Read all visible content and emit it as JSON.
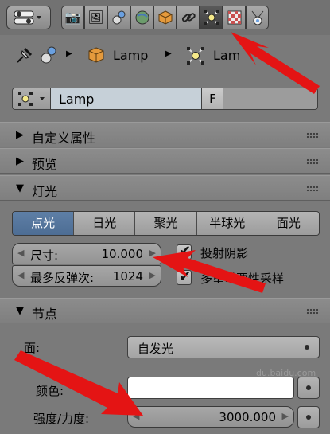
{
  "toolbar": {
    "icons": [
      "view-toggle-icon",
      "render-icon",
      "render-layers-icon",
      "scene-icon",
      "world-icon",
      "object-icon",
      "constraints-icon",
      "lamp-data-icon",
      "texture-icon",
      "particles-icon"
    ],
    "active": "lamp-data-icon"
  },
  "breadcrumb": {
    "object_name": "Lamp",
    "data_name": "Lam"
  },
  "datablock": {
    "name": "Lamp",
    "fake_user": "F"
  },
  "panels": {
    "custom_props": "自定义属性",
    "preview": "预览",
    "lamp": "灯光",
    "nodes": "节点"
  },
  "lamp_types": [
    "点光",
    "日光",
    "聚光",
    "半球光",
    "面光"
  ],
  "lamp_type_selected": "点光",
  "size": {
    "label": "尺寸:",
    "value": "10.000"
  },
  "max_bounces": {
    "label": "最多反弹次:",
    "value": "1024"
  },
  "cast_shadow": {
    "label": "投射阴影",
    "checked": true
  },
  "mis": {
    "label": "多重重要性采样",
    "checked": true
  },
  "nodes": {
    "surface_label": "面:",
    "surface_value": "自发光",
    "color_label": "颜色:",
    "color_value": "#ffffff",
    "strength_label": "强度/力度:",
    "strength_value": "3000.000"
  },
  "watermark": "du.baidu.com",
  "colors": {
    "accent": "#5b7ca4",
    "annotation": "#e41414"
  }
}
